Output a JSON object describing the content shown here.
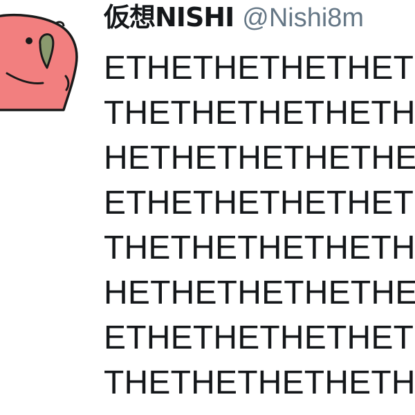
{
  "tweet": {
    "author": {
      "display_name": "仮想NISHI",
      "handle": "@Nishi8m",
      "avatar_icon": "parrot-avatar-icon"
    },
    "text_lines": [
      "ETHETHETHETHETHETH",
      "THETHETHETHETHETHE",
      "HETHETHETHETHETHET",
      "ETHETHETHETHETHETH",
      "THETHETHETHETHETHE",
      "HETHETHETHETHETHET",
      "ETHETHETHETHETHETH",
      "THETHETHETHETHETHE"
    ]
  },
  "colors": {
    "avatar_body": "#f27f7f",
    "avatar_beak": "#8a9a6e",
    "avatar_outline": "#1a1a1a",
    "name_text": "#14171a",
    "handle_text": "#657786"
  }
}
